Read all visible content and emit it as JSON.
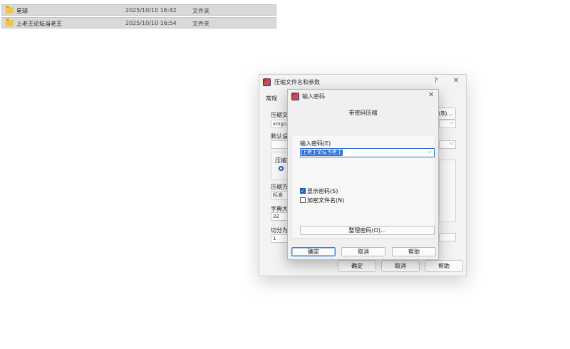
{
  "file_list": [
    {
      "name": "星球",
      "date": "2025/10/10 16:42",
      "type": "文件夹"
    },
    {
      "name": "上老王论坛当老王",
      "date": "2025/10/10 16:54",
      "type": "文件夹"
    }
  ],
  "archive_dialog": {
    "title": "压缩文件名和参数",
    "help_icon": "?",
    "close_icon": "✕",
    "tab_general": "常规",
    "archive_name_label": "压缩文",
    "archive_name_value": "xingqiu",
    "browse_label": "(B)...",
    "default_label": "默认设",
    "format_label": "压缩文",
    "method_label": "压缩方",
    "method_value": "标准",
    "dict_label": "字典大",
    "dict_value": "32",
    "split_label": "切分为",
    "split_value": "1",
    "ok_label": "确定",
    "cancel_label": "取消",
    "help_label": "帮助"
  },
  "password_dialog": {
    "title": "输入密码",
    "close_icon": "✕",
    "subtitle": "带密码压缩",
    "enter_label": "输入密码(E)",
    "password_value": "上老王论坛当老王",
    "show_password_label": "显示密码(S)",
    "show_password_checked": true,
    "encrypt_names_label": "加密文件名(N)",
    "encrypt_names_checked": false,
    "organize_label": "整理密码(O)...",
    "ok_label": "确定",
    "cancel_label": "取消",
    "help_label": "帮助"
  },
  "colors": {
    "accent": "#2e6fd0",
    "folder": "#f2c54a",
    "selection_row": "#d9d9d9"
  }
}
